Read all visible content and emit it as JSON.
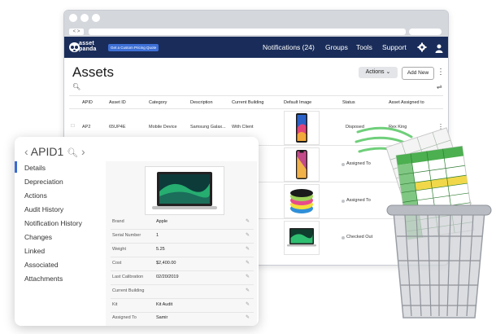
{
  "browser": {
    "nav_arrows": "< >"
  },
  "app": {
    "logo_line1": "asset",
    "logo_line2": "panda",
    "quote_button": "Get a Custom Pricing Quote",
    "nav": [
      "Notifications (24)",
      "Groups",
      "Tools",
      "Support"
    ],
    "icons": [
      "gear-icon",
      "user-icon"
    ]
  },
  "assets": {
    "title": "Assets",
    "actions_label": "Actions",
    "add_new_label": "Add New",
    "columns": [
      "APID",
      "Asset ID",
      "Category",
      "Description",
      "Current Building",
      "Default Image",
      "Status",
      "Asset Assigned to"
    ],
    "rows": [
      {
        "apid": "AP2",
        "asset_id": "65UP4E",
        "category": "Mobile Device",
        "description": "Samsung Galax...",
        "building": "With Client",
        "status": "Disposed",
        "assigned": "Rex King"
      },
      {
        "status": "Assigned To"
      },
      {
        "status": "Assigned To"
      },
      {
        "status": "Checked Out"
      }
    ]
  },
  "detail": {
    "title": "APID1",
    "menu": [
      "Details",
      "Depreciation",
      "Actions",
      "Audit History",
      "Notification History",
      "Changes",
      "Linked",
      "Associated",
      "Attachments"
    ],
    "active_index": 0,
    "fields": [
      {
        "label": "Brand",
        "value": "Apple"
      },
      {
        "label": "Serial Number",
        "value": "1"
      },
      {
        "label": "Weight",
        "value": "5.25"
      },
      {
        "label": "Cost",
        "value": "$2,400.00"
      },
      {
        "label": "Last Calibration",
        "value": "02/20/2019"
      },
      {
        "label": "Current Building",
        "value": ""
      },
      {
        "label": "Kit",
        "value": "Kit Audit"
      },
      {
        "label": "Assigned To",
        "value": "Samir"
      }
    ]
  },
  "colors": {
    "appbar": "#1a2d5a",
    "accent": "#3a6bd1",
    "bin": "#b9bcc2",
    "spreadsheet_green": "#4caf50"
  }
}
